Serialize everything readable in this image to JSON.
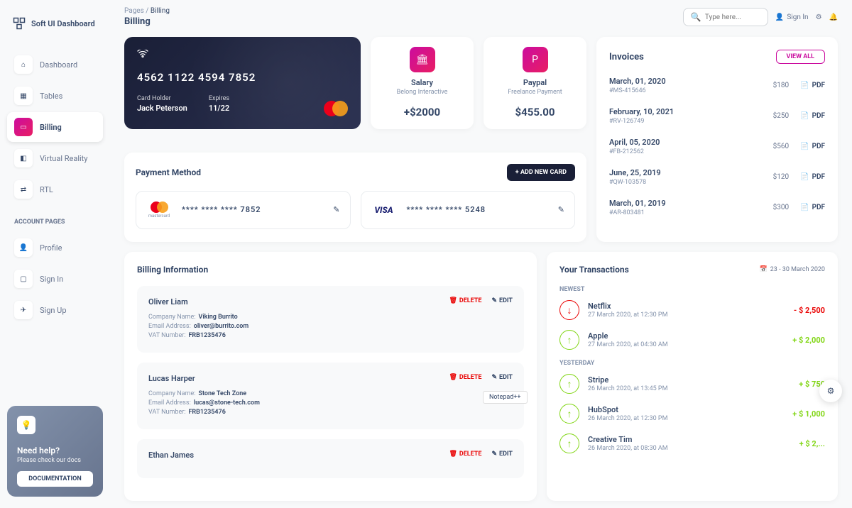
{
  "brand": "Soft UI Dashboard",
  "breadcrumb": {
    "parent": "Pages",
    "current": "Billing"
  },
  "page_title": "Billing",
  "search": {
    "placeholder": "Type here..."
  },
  "signin": "Sign In",
  "nav": {
    "items": [
      {
        "label": "Dashboard",
        "icon": "⌂"
      },
      {
        "label": "Tables",
        "icon": "▦"
      },
      {
        "label": "Billing",
        "icon": "▭"
      },
      {
        "label": "Virtual Reality",
        "icon": "◧"
      },
      {
        "label": "RTL",
        "icon": "⇄"
      }
    ],
    "section": "ACCOUNT PAGES",
    "account": [
      {
        "label": "Profile",
        "icon": "👤"
      },
      {
        "label": "Sign In",
        "icon": "▢"
      },
      {
        "label": "Sign Up",
        "icon": "✈"
      }
    ]
  },
  "help": {
    "title": "Need help?",
    "subtitle": "Please check our docs",
    "button": "DOCUMENTATION"
  },
  "card": {
    "number": "4562   1122   4594   7852",
    "holder_label": "Card Holder",
    "holder": "Jack Peterson",
    "expires_label": "Expires",
    "expires": "11/22"
  },
  "stats": [
    {
      "title": "Salary",
      "subtitle": "Belong Interactive",
      "value": "+$2000",
      "icon": "🏛"
    },
    {
      "title": "Paypal",
      "subtitle": "Freelance Payment",
      "value": "$455.00",
      "icon": "P"
    }
  ],
  "invoices": {
    "title": "Invoices",
    "viewall": "VIEW ALL",
    "items": [
      {
        "date": "March, 01, 2020",
        "id": "#MS-415646",
        "amount": "$180",
        "pdf": "PDF"
      },
      {
        "date": "February, 10, 2021",
        "id": "#RV-126749",
        "amount": "$250",
        "pdf": "PDF"
      },
      {
        "date": "April, 05, 2020",
        "id": "#FB-212562",
        "amount": "$560",
        "pdf": "PDF"
      },
      {
        "date": "June, 25, 2019",
        "id": "#QW-103578",
        "amount": "$120",
        "pdf": "PDF"
      },
      {
        "date": "March, 01, 2019",
        "id": "#AR-803481",
        "amount": "$300",
        "pdf": "PDF"
      }
    ]
  },
  "payment": {
    "title": "Payment Method",
    "add": "+  ADD NEW CARD",
    "cards": [
      {
        "brand": "mastercard",
        "masked": "****   ****   ****   7852"
      },
      {
        "brand": "visa",
        "masked": "****   ****   ****   5248"
      }
    ]
  },
  "billing": {
    "title": "Billing Information",
    "labels": {
      "company": "Company Name:",
      "email": "Email Address:",
      "vat": "VAT Number:",
      "delete": "DELETE",
      "edit": "EDIT"
    },
    "items": [
      {
        "name": "Oliver Liam",
        "company": "Viking Burrito",
        "email": "oliver@burrito.com",
        "vat": "FRB1235476"
      },
      {
        "name": "Lucas Harper",
        "company": "Stone Tech Zone",
        "email": "lucas@stone-tech.com",
        "vat": "FRB1235476"
      },
      {
        "name": "Ethan James",
        "company": "",
        "email": "",
        "vat": ""
      }
    ]
  },
  "transactions": {
    "title": "Your Transactions",
    "range": "23 - 30 March 2020",
    "sections": {
      "newest": "NEWEST",
      "yesterday": "YESTERDAY"
    },
    "newest": [
      {
        "name": "Netflix",
        "date": "27 March 2020, at 12:30 PM",
        "amount": "- $ 2,500",
        "dir": "down"
      },
      {
        "name": "Apple",
        "date": "27 March 2020, at 04:30 AM",
        "amount": "+ $ 2,000",
        "dir": "up"
      }
    ],
    "yesterday": [
      {
        "name": "Stripe",
        "date": "26 March 2020, at 13:45 PM",
        "amount": "+ $ 750",
        "dir": "up"
      },
      {
        "name": "HubSpot",
        "date": "26 March 2020, at 12:30 PM",
        "amount": "+ $ 1,000",
        "dir": "up"
      },
      {
        "name": "Creative Tim",
        "date": "26 March 2020, at 08:30 AM",
        "amount": "+ $ 2,...",
        "dir": "up"
      }
    ]
  },
  "misc": {
    "notepad": "Notepad++"
  }
}
